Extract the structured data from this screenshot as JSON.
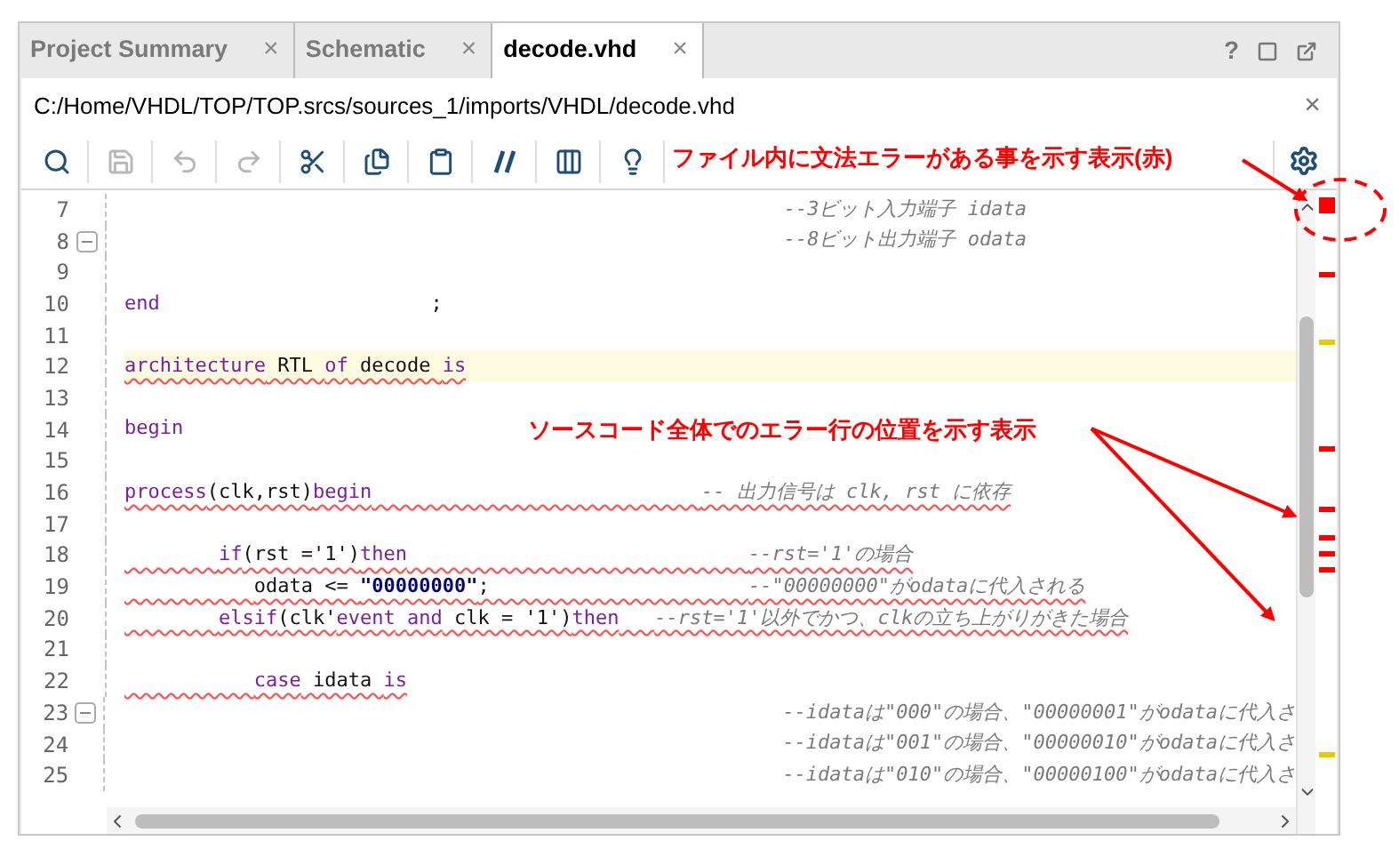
{
  "tabs": [
    {
      "label": "Project Summary",
      "selected": false,
      "close": "×"
    },
    {
      "label": "Schematic",
      "selected": false,
      "close": "×"
    },
    {
      "label": "decode.vhd",
      "selected": true,
      "close": "×"
    }
  ],
  "window_controls": {
    "help": "?"
  },
  "file_path": {
    "text": "C:/Home/VHDL/TOP/TOP.srcs/sources_1/imports/VHDL/decode.vhd",
    "close": "×"
  },
  "toolbar": [
    {
      "kind": "search",
      "disabled": false
    },
    {
      "kind": "save",
      "disabled": true
    },
    {
      "kind": "undo",
      "disabled": true
    },
    {
      "kind": "redo",
      "disabled": true
    },
    {
      "kind": "cut",
      "disabled": false
    },
    {
      "kind": "copy",
      "disabled": false
    },
    {
      "kind": "paste",
      "disabled": false
    },
    {
      "kind": "comment",
      "disabled": false
    },
    {
      "kind": "columns",
      "disabled": false
    },
    {
      "kind": "hint",
      "disabled": false
    }
  ],
  "code_lines": [
    {
      "number": "7",
      "fold": false,
      "error": false,
      "highlighted": false,
      "segments": [
        {
          "kind": "comment",
          "text": "--3ビット入力端子 idata"
        }
      ]
    },
    {
      "number": "8",
      "fold": true,
      "error": false,
      "highlighted": false,
      "segments": [
        {
          "kind": "comment",
          "text": "--8ビット出力端子 odata"
        }
      ]
    },
    {
      "number": "9",
      "fold": false
    },
    {
      "number": "10",
      "fold": false,
      "error": false,
      "highlighted": false,
      "segments": [
        {
          "kind": "keyword",
          "text": "end"
        },
        {
          "kind": "plain",
          "text": ";"
        }
      ]
    },
    {
      "number": "11",
      "fold": false
    },
    {
      "number": "12",
      "fold": false,
      "error": true,
      "highlighted": true,
      "segments": [
        {
          "kind": "keyword",
          "text": "architecture"
        },
        {
          "kind": "plain",
          "text": " RTL "
        },
        {
          "kind": "keyword",
          "text": "of"
        },
        {
          "kind": "plain",
          "text": " decode "
        },
        {
          "kind": "keyword",
          "text": "is"
        }
      ]
    },
    {
      "number": "13",
      "fold": false
    },
    {
      "number": "14",
      "fold": false,
      "error": false,
      "highlighted": false,
      "segments": [
        {
          "kind": "keyword",
          "text": "begin"
        }
      ]
    },
    {
      "number": "15",
      "fold": false
    },
    {
      "number": "16",
      "fold": false,
      "error": true,
      "highlighted": false,
      "segments": [
        {
          "kind": "keyword",
          "text": "process"
        },
        {
          "kind": "plain",
          "text": "(clk,rst)"
        },
        {
          "kind": "keyword",
          "text": "begin"
        },
        {
          "kind": "comment",
          "text": "-- 出力信号は clk, rst に依存"
        }
      ]
    },
    {
      "number": "17",
      "fold": false
    },
    {
      "number": "18",
      "fold": false,
      "error": true,
      "highlighted": false,
      "segments": [
        {
          "kind": "keyword",
          "text": "if"
        },
        {
          "kind": "plain",
          "text": "(rst ='1')"
        },
        {
          "kind": "keyword",
          "text": "then"
        },
        {
          "kind": "comment",
          "text": "--rst='1'の場合"
        }
      ]
    },
    {
      "number": "19",
      "fold": false,
      "error": true,
      "highlighted": false,
      "segments": [
        {
          "kind": "plain",
          "text": "odata <= "
        },
        {
          "kind": "string",
          "text": "\"00000000\""
        },
        {
          "kind": "plain",
          "text": ";"
        },
        {
          "kind": "comment",
          "text": "--\"00000000\"がodataに代入される"
        }
      ]
    },
    {
      "number": "20",
      "fold": false,
      "error": true,
      "highlighted": false,
      "segments": [
        {
          "kind": "keyword",
          "text": "elsif"
        },
        {
          "kind": "plain",
          "text": "(clk'"
        },
        {
          "kind": "keyword",
          "text": "event"
        },
        {
          "kind": "keyword",
          "text": "and"
        },
        {
          "kind": "plain",
          "text": " clk = '1')"
        },
        {
          "kind": "keyword",
          "text": "then"
        },
        {
          "kind": "comment",
          "text": "--rst='1'以外でかつ、clkの立ち上がりがきた場合"
        }
      ]
    },
    {
      "number": "21",
      "fold": false
    },
    {
      "number": "22",
      "fold": false,
      "error": true,
      "highlighted": false,
      "segments": [
        {
          "kind": "keyword",
          "text": "case"
        },
        {
          "kind": "plain",
          "text": " idata "
        },
        {
          "kind": "keyword",
          "text": "is"
        }
      ]
    },
    {
      "number": "23",
      "fold": true,
      "error": false,
      "highlighted": false,
      "segments": [
        {
          "kind": "comment",
          "text": "--idataは\"000\"の場合、\"00000001\"がodataに代入さ"
        }
      ]
    },
    {
      "number": "24",
      "fold": false,
      "error": false,
      "highlighted": false,
      "segments": [
        {
          "kind": "comment",
          "text": "--idataは\"001\"の場合、\"00000010\"がodataに代入さ"
        }
      ]
    },
    {
      "number": "25",
      "fold": false,
      "error": false,
      "highlighted": false,
      "segments": [
        {
          "kind": "comment",
          "text": "--idataは\"010\"の場合、\"00000100\"がodataに代入さ"
        }
      ]
    }
  ],
  "overview_markers": [
    {
      "color": "#ff0000"
    },
    {
      "color": "#e8c800"
    },
    {
      "color": "#ff0000"
    },
    {
      "color": "#ff0000"
    },
    {
      "color": "#ff0000"
    },
    {
      "color": "#ff0000"
    },
    {
      "color": "#ff0000"
    },
    {
      "color": "#e8c800"
    }
  ],
  "error_status": {
    "color": "#ff0000"
  },
  "annotations": [
    {
      "text": "ファイル内に文法エラーがある事を示す表示(赤)"
    },
    {
      "text": "ソースコード全体でのエラー行の位置を示す表示"
    }
  ]
}
